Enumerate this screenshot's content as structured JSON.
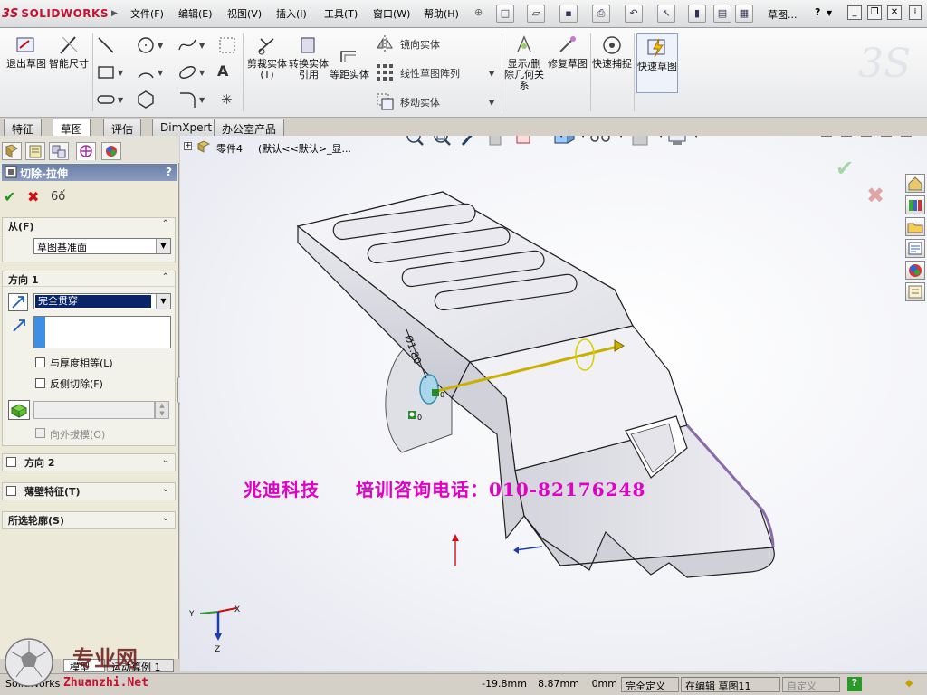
{
  "app": {
    "logo_ds": "3S",
    "logo_name": "SOLIDWORKS",
    "document_title": "草图..."
  },
  "menu": [
    "文件(F)",
    "编辑(E)",
    "视图(V)",
    "插入(I)",
    "工具(T)",
    "窗口(W)",
    "帮助(H)"
  ],
  "ribbon": {
    "exit_sketch": "退出草图",
    "smart_dimension": "智能尺寸",
    "trim": "剪裁实体(T)",
    "convert": "转换实体引用",
    "offset": "等距实体",
    "mirror": "镜向实体",
    "linear_pattern": "线性草图阵列",
    "move": "移动实体",
    "show_delete_relations": "显示/删除几何关系",
    "repair_sketch": "修复草图",
    "quick_snaps": "快速捕捉",
    "rapid_sketch": "快速草图"
  },
  "tabs": [
    "特征",
    "草图",
    "评估",
    "DimXpert",
    "办公室产品"
  ],
  "tree": {
    "part": "零件4",
    "config": "(默认<<默认>_显..."
  },
  "property_manager": {
    "title": "切除-拉伸",
    "help": "?",
    "from": {
      "header": "从(F)",
      "value": "草图基准面"
    },
    "direction1": {
      "header": "方向 1",
      "end_condition": "完全贯穿",
      "equal_thickness": "与厚度相等(L)",
      "flip_side": "反侧切除(F)",
      "draft_outward": "向外拔模(O)"
    },
    "direction2": {
      "header": "方向 2"
    },
    "thin_feature": {
      "header": "薄壁特征(T)"
    },
    "selected_contours": {
      "header": "所选轮廓(S)"
    }
  },
  "viewport": {
    "dimension_label": "Ø1.80",
    "watermark": "兆迪科技     培训咨询电话：010-82176248",
    "watermark_left": "兆迪科技",
    "watermark_right": "培训咨询电话：010-82176248",
    "triad": {
      "x": "X",
      "y": "Y",
      "z": "Z"
    }
  },
  "bottom_tabs": [
    "模型",
    "运动算例 1"
  ],
  "status": {
    "app_name": "SolidWorks",
    "x": "-19.8mm",
    "y": "8.87mm",
    "z": "0mm",
    "state": "完全定义",
    "editing": "在编辑 草图11",
    "custom": "自定义",
    "help_icon": "?"
  },
  "site_watermark": {
    "name": "专业网",
    "url": "Zhuanzhi.Net"
  }
}
